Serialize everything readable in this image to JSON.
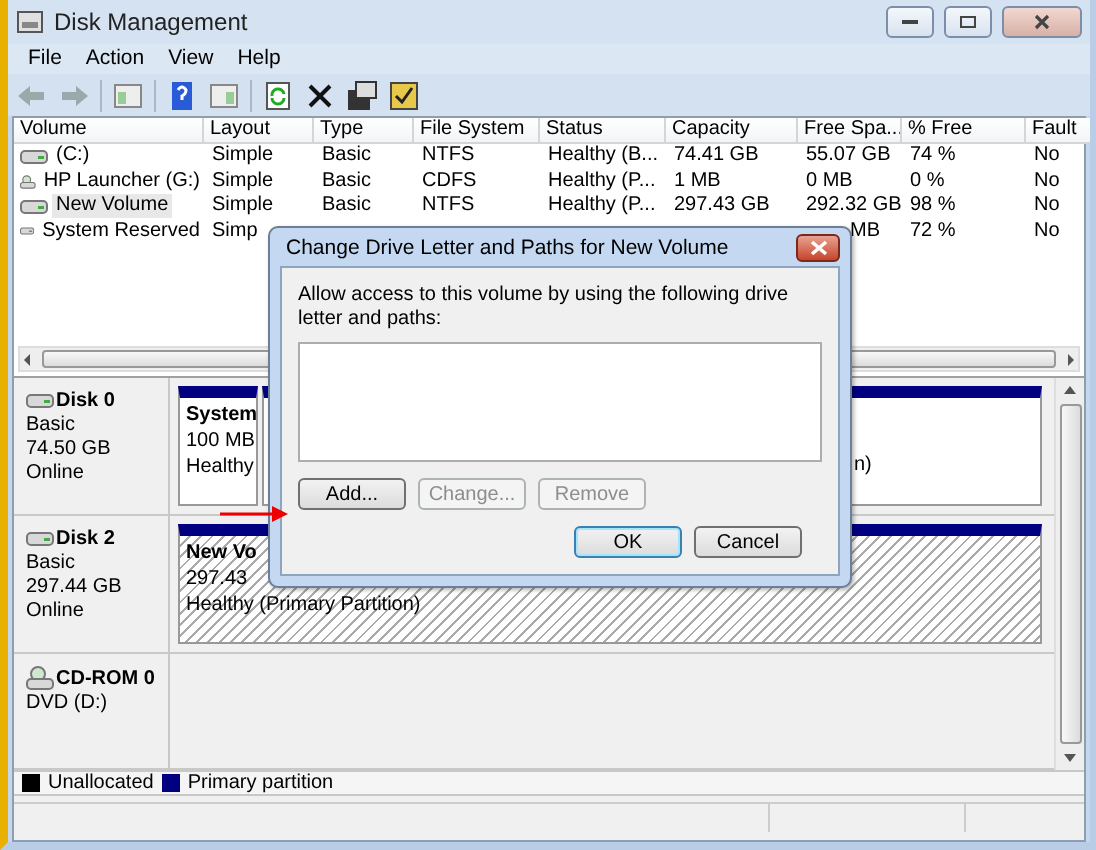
{
  "window": {
    "title": "Disk Management"
  },
  "menu": [
    "File",
    "Action",
    "View",
    "Help"
  ],
  "table": {
    "columns": [
      "Volume",
      "Layout",
      "Type",
      "File System",
      "Status",
      "Capacity",
      "Free Spa...",
      "% Free",
      "Fault"
    ],
    "rows": [
      {
        "kind": "disk",
        "selected": false,
        "cells": [
          "(C:)",
          "Simple",
          "Basic",
          "NTFS",
          "Healthy (B...",
          "74.41 GB",
          "55.07 GB",
          "74 %",
          "No"
        ]
      },
      {
        "kind": "cd",
        "selected": false,
        "cells": [
          "HP Launcher (G:)",
          "Simple",
          "Basic",
          "CDFS",
          "Healthy (P...",
          "1 MB",
          "0 MB",
          "0 %",
          "No"
        ]
      },
      {
        "kind": "disk",
        "selected": true,
        "cells": [
          "New Volume",
          "Simple",
          "Basic",
          "NTFS",
          "Healthy (P...",
          "297.43 GB",
          "292.32 GB",
          "98 %",
          "No"
        ]
      },
      {
        "kind": "disk",
        "selected": false,
        "cells": [
          "System Reserved",
          "Simp",
          null,
          null,
          null,
          null,
          "MB",
          "72 %",
          "No"
        ]
      }
    ]
  },
  "disks": [
    {
      "kind": "disk",
      "name": "Disk 0",
      "lines": [
        "Basic",
        "74.50 GB",
        "Online"
      ],
      "partitions": [
        {
          "selected": false,
          "lines": [
            "System",
            "100 MB",
            "Healthy"
          ]
        },
        {
          "selected": false,
          "footer": "n)"
        }
      ]
    },
    {
      "kind": "disk",
      "name": "Disk 2",
      "lines": [
        "Basic",
        "297.44 GB",
        "Online"
      ],
      "partitions": [
        {
          "selected": true,
          "lines": [
            "New Vo",
            "297.43",
            "Healthy (Primary Partition)"
          ]
        }
      ]
    },
    {
      "kind": "cd",
      "name": "CD-ROM 0",
      "lines": [
        "DVD (D:)"
      ]
    }
  ],
  "legend": [
    {
      "label": "Unallocated",
      "color": "#000000"
    },
    {
      "label": "Primary partition",
      "color": "#000080"
    }
  ],
  "dialog": {
    "title": "Change Drive Letter and Paths for New Volume",
    "prompt": "Allow access to this volume by using the following drive letter and paths:",
    "buttons": [
      {
        "label": "Add...",
        "disabled": false,
        "default": false
      },
      {
        "label": "Change...",
        "disabled": true,
        "default": false
      },
      {
        "label": "Remove",
        "disabled": true,
        "default": false
      }
    ],
    "footer_buttons": [
      {
        "label": "OK",
        "disabled": false,
        "default": true
      },
      {
        "label": "Cancel",
        "disabled": false,
        "default": false
      }
    ]
  }
}
